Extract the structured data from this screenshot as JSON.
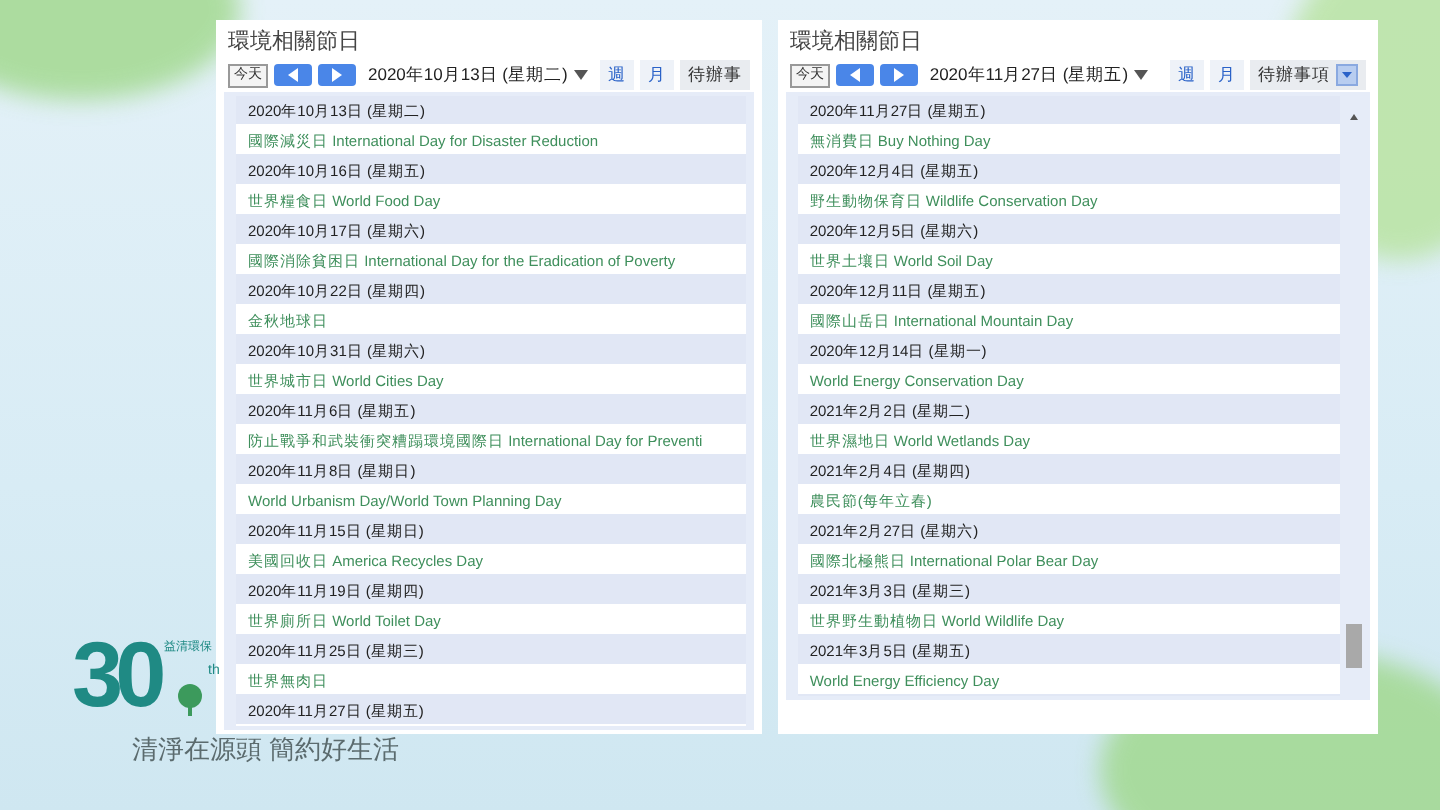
{
  "panels": [
    {
      "title": "環境相關節日",
      "today": "今天",
      "current_date": "2020年10月13日 (星期二)",
      "views": [
        {
          "label": "週",
          "selected": false
        },
        {
          "label": "月",
          "selected": false
        },
        {
          "label": "待辦事",
          "selected": true,
          "has_menu": false
        }
      ],
      "scrollbar": false,
      "rows": [
        {
          "kind": "date",
          "text": "2020年10月13日 (星期二)"
        },
        {
          "kind": "event",
          "text": "國際減災日 International Day for Disaster Reduction"
        },
        {
          "kind": "date",
          "text": "2020年10月16日 (星期五)"
        },
        {
          "kind": "event",
          "text": "世界糧食日 World Food Day"
        },
        {
          "kind": "date",
          "text": "2020年10月17日 (星期六)"
        },
        {
          "kind": "event",
          "text": "國際消除貧困日 International Day for the Eradication of Poverty"
        },
        {
          "kind": "date",
          "text": "2020年10月22日 (星期四)"
        },
        {
          "kind": "event",
          "text": "金秋地球日"
        },
        {
          "kind": "date",
          "text": "2020年10月31日 (星期六)"
        },
        {
          "kind": "event",
          "text": "世界城市日 World Cities Day"
        },
        {
          "kind": "date",
          "text": "2020年11月6日 (星期五)"
        },
        {
          "kind": "event",
          "text": "防止戰爭和武裝衝突糟蹋環境國際日 International Day for Preventi"
        },
        {
          "kind": "date",
          "text": "2020年11月8日 (星期日)"
        },
        {
          "kind": "event",
          "text": "World Urbanism Day/World Town Planning Day"
        },
        {
          "kind": "date",
          "text": "2020年11月15日 (星期日)"
        },
        {
          "kind": "event",
          "text": "美國回收日 America Recycles Day"
        },
        {
          "kind": "date",
          "text": "2020年11月19日 (星期四)"
        },
        {
          "kind": "event",
          "text": "世界廁所日 World Toilet Day"
        },
        {
          "kind": "date",
          "text": "2020年11月25日 (星期三)"
        },
        {
          "kind": "event",
          "text": "世界無肉日"
        },
        {
          "kind": "date",
          "text": "2020年11月27日 (星期五)"
        }
      ]
    },
    {
      "title": "環境相關節日",
      "today": "今天",
      "current_date": "2020年11月27日 (星期五)",
      "views": [
        {
          "label": "週",
          "selected": false
        },
        {
          "label": "月",
          "selected": false
        },
        {
          "label": "待辦事項",
          "selected": true,
          "has_menu": true
        }
      ],
      "scrollbar": true,
      "rows": [
        {
          "kind": "date",
          "text": "2020年11月27日 (星期五)"
        },
        {
          "kind": "event",
          "text": "無消費日 Buy Nothing Day"
        },
        {
          "kind": "date",
          "text": "2020年12月4日 (星期五)"
        },
        {
          "kind": "event",
          "text": "野生動物保育日 Wildlife Conservation Day"
        },
        {
          "kind": "date",
          "text": "2020年12月5日 (星期六)"
        },
        {
          "kind": "event",
          "text": "世界土壤日 World Soil Day"
        },
        {
          "kind": "date",
          "text": "2020年12月11日 (星期五)"
        },
        {
          "kind": "event",
          "text": "國際山岳日 International Mountain Day"
        },
        {
          "kind": "date",
          "text": "2020年12月14日 (星期一)"
        },
        {
          "kind": "event",
          "text": "World Energy Conservation Day"
        },
        {
          "kind": "date",
          "text": "2021年2月2日 (星期二)"
        },
        {
          "kind": "event",
          "text": "世界濕地日 World Wetlands Day"
        },
        {
          "kind": "date",
          "text": "2021年2月4日 (星期四)"
        },
        {
          "kind": "event",
          "text": "農民節(每年立春)"
        },
        {
          "kind": "date",
          "text": "2021年2月27日 (星期六)"
        },
        {
          "kind": "event",
          "text": "國際北極熊日 International Polar Bear Day"
        },
        {
          "kind": "date",
          "text": "2021年3月3日 (星期三)"
        },
        {
          "kind": "event",
          "text": "世界野生動植物日 World Wildlife Day"
        },
        {
          "kind": "date",
          "text": "2021年3月5日 (星期五)"
        },
        {
          "kind": "event",
          "text": "World Energy Efficiency Day"
        }
      ]
    }
  ],
  "logo": {
    "number": "30",
    "suffix": "th",
    "small_text": "益清環保"
  },
  "slogan": "清淨在源頭 簡約好生活"
}
